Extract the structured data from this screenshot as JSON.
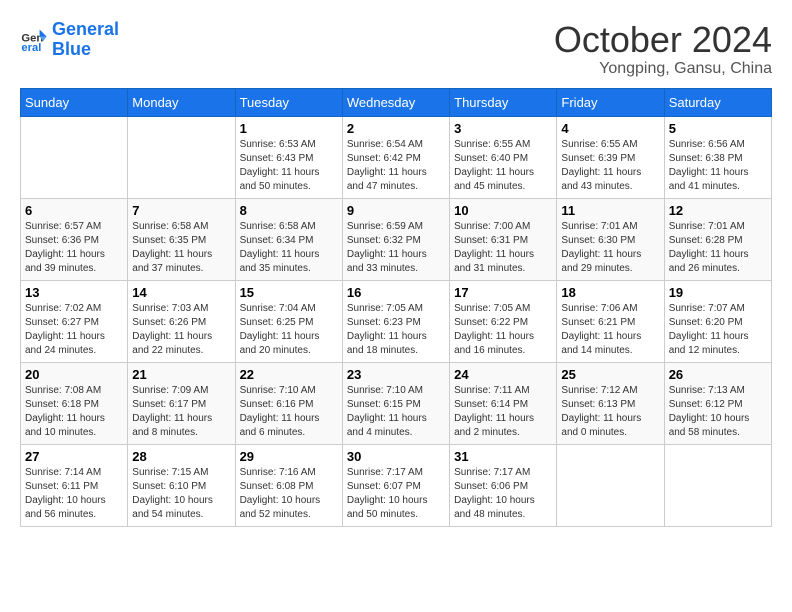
{
  "header": {
    "logo_line1": "General",
    "logo_line2": "Blue",
    "month": "October 2024",
    "location": "Yongping, Gansu, China"
  },
  "weekdays": [
    "Sunday",
    "Monday",
    "Tuesday",
    "Wednesday",
    "Thursday",
    "Friday",
    "Saturday"
  ],
  "weeks": [
    [
      {
        "day": "",
        "sunrise": "",
        "sunset": "",
        "daylight": ""
      },
      {
        "day": "",
        "sunrise": "",
        "sunset": "",
        "daylight": ""
      },
      {
        "day": "1",
        "sunrise": "Sunrise: 6:53 AM",
        "sunset": "Sunset: 6:43 PM",
        "daylight": "Daylight: 11 hours and 50 minutes."
      },
      {
        "day": "2",
        "sunrise": "Sunrise: 6:54 AM",
        "sunset": "Sunset: 6:42 PM",
        "daylight": "Daylight: 11 hours and 47 minutes."
      },
      {
        "day": "3",
        "sunrise": "Sunrise: 6:55 AM",
        "sunset": "Sunset: 6:40 PM",
        "daylight": "Daylight: 11 hours and 45 minutes."
      },
      {
        "day": "4",
        "sunrise": "Sunrise: 6:55 AM",
        "sunset": "Sunset: 6:39 PM",
        "daylight": "Daylight: 11 hours and 43 minutes."
      },
      {
        "day": "5",
        "sunrise": "Sunrise: 6:56 AM",
        "sunset": "Sunset: 6:38 PM",
        "daylight": "Daylight: 11 hours and 41 minutes."
      }
    ],
    [
      {
        "day": "6",
        "sunrise": "Sunrise: 6:57 AM",
        "sunset": "Sunset: 6:36 PM",
        "daylight": "Daylight: 11 hours and 39 minutes."
      },
      {
        "day": "7",
        "sunrise": "Sunrise: 6:58 AM",
        "sunset": "Sunset: 6:35 PM",
        "daylight": "Daylight: 11 hours and 37 minutes."
      },
      {
        "day": "8",
        "sunrise": "Sunrise: 6:58 AM",
        "sunset": "Sunset: 6:34 PM",
        "daylight": "Daylight: 11 hours and 35 minutes."
      },
      {
        "day": "9",
        "sunrise": "Sunrise: 6:59 AM",
        "sunset": "Sunset: 6:32 PM",
        "daylight": "Daylight: 11 hours and 33 minutes."
      },
      {
        "day": "10",
        "sunrise": "Sunrise: 7:00 AM",
        "sunset": "Sunset: 6:31 PM",
        "daylight": "Daylight: 11 hours and 31 minutes."
      },
      {
        "day": "11",
        "sunrise": "Sunrise: 7:01 AM",
        "sunset": "Sunset: 6:30 PM",
        "daylight": "Daylight: 11 hours and 29 minutes."
      },
      {
        "day": "12",
        "sunrise": "Sunrise: 7:01 AM",
        "sunset": "Sunset: 6:28 PM",
        "daylight": "Daylight: 11 hours and 26 minutes."
      }
    ],
    [
      {
        "day": "13",
        "sunrise": "Sunrise: 7:02 AM",
        "sunset": "Sunset: 6:27 PM",
        "daylight": "Daylight: 11 hours and 24 minutes."
      },
      {
        "day": "14",
        "sunrise": "Sunrise: 7:03 AM",
        "sunset": "Sunset: 6:26 PM",
        "daylight": "Daylight: 11 hours and 22 minutes."
      },
      {
        "day": "15",
        "sunrise": "Sunrise: 7:04 AM",
        "sunset": "Sunset: 6:25 PM",
        "daylight": "Daylight: 11 hours and 20 minutes."
      },
      {
        "day": "16",
        "sunrise": "Sunrise: 7:05 AM",
        "sunset": "Sunset: 6:23 PM",
        "daylight": "Daylight: 11 hours and 18 minutes."
      },
      {
        "day": "17",
        "sunrise": "Sunrise: 7:05 AM",
        "sunset": "Sunset: 6:22 PM",
        "daylight": "Daylight: 11 hours and 16 minutes."
      },
      {
        "day": "18",
        "sunrise": "Sunrise: 7:06 AM",
        "sunset": "Sunset: 6:21 PM",
        "daylight": "Daylight: 11 hours and 14 minutes."
      },
      {
        "day": "19",
        "sunrise": "Sunrise: 7:07 AM",
        "sunset": "Sunset: 6:20 PM",
        "daylight": "Daylight: 11 hours and 12 minutes."
      }
    ],
    [
      {
        "day": "20",
        "sunrise": "Sunrise: 7:08 AM",
        "sunset": "Sunset: 6:18 PM",
        "daylight": "Daylight: 11 hours and 10 minutes."
      },
      {
        "day": "21",
        "sunrise": "Sunrise: 7:09 AM",
        "sunset": "Sunset: 6:17 PM",
        "daylight": "Daylight: 11 hours and 8 minutes."
      },
      {
        "day": "22",
        "sunrise": "Sunrise: 7:10 AM",
        "sunset": "Sunset: 6:16 PM",
        "daylight": "Daylight: 11 hours and 6 minutes."
      },
      {
        "day": "23",
        "sunrise": "Sunrise: 7:10 AM",
        "sunset": "Sunset: 6:15 PM",
        "daylight": "Daylight: 11 hours and 4 minutes."
      },
      {
        "day": "24",
        "sunrise": "Sunrise: 7:11 AM",
        "sunset": "Sunset: 6:14 PM",
        "daylight": "Daylight: 11 hours and 2 minutes."
      },
      {
        "day": "25",
        "sunrise": "Sunrise: 7:12 AM",
        "sunset": "Sunset: 6:13 PM",
        "daylight": "Daylight: 11 hours and 0 minutes."
      },
      {
        "day": "26",
        "sunrise": "Sunrise: 7:13 AM",
        "sunset": "Sunset: 6:12 PM",
        "daylight": "Daylight: 10 hours and 58 minutes."
      }
    ],
    [
      {
        "day": "27",
        "sunrise": "Sunrise: 7:14 AM",
        "sunset": "Sunset: 6:11 PM",
        "daylight": "Daylight: 10 hours and 56 minutes."
      },
      {
        "day": "28",
        "sunrise": "Sunrise: 7:15 AM",
        "sunset": "Sunset: 6:10 PM",
        "daylight": "Daylight: 10 hours and 54 minutes."
      },
      {
        "day": "29",
        "sunrise": "Sunrise: 7:16 AM",
        "sunset": "Sunset: 6:08 PM",
        "daylight": "Daylight: 10 hours and 52 minutes."
      },
      {
        "day": "30",
        "sunrise": "Sunrise: 7:17 AM",
        "sunset": "Sunset: 6:07 PM",
        "daylight": "Daylight: 10 hours and 50 minutes."
      },
      {
        "day": "31",
        "sunrise": "Sunrise: 7:17 AM",
        "sunset": "Sunset: 6:06 PM",
        "daylight": "Daylight: 10 hours and 48 minutes."
      },
      {
        "day": "",
        "sunrise": "",
        "sunset": "",
        "daylight": ""
      },
      {
        "day": "",
        "sunrise": "",
        "sunset": "",
        "daylight": ""
      }
    ]
  ]
}
